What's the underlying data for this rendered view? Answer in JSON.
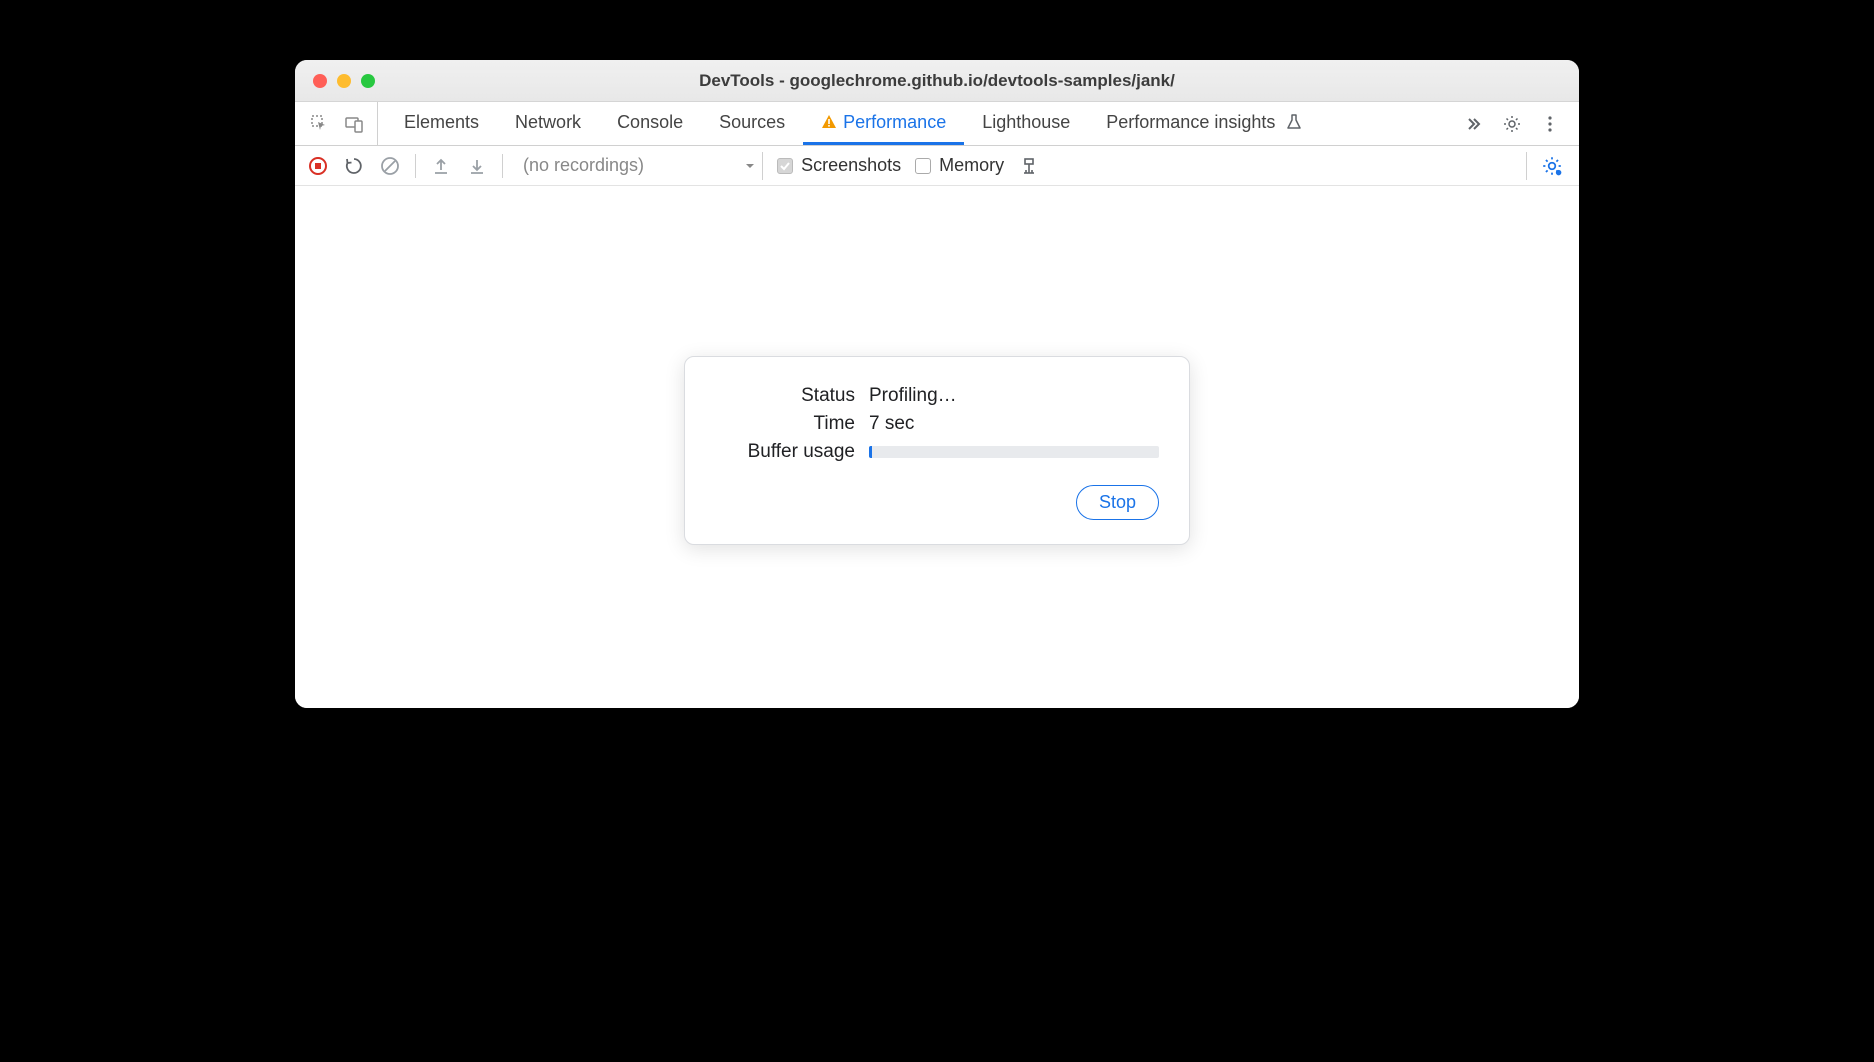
{
  "window": {
    "title": "DevTools - googlechrome.github.io/devtools-samples/jank/"
  },
  "tabs": {
    "items": [
      {
        "label": "Elements"
      },
      {
        "label": "Network"
      },
      {
        "label": "Console"
      },
      {
        "label": "Sources"
      },
      {
        "label": "Performance",
        "active": true,
        "warning": true
      },
      {
        "label": "Lighthouse"
      },
      {
        "label": "Performance insights"
      }
    ]
  },
  "toolbar": {
    "recordings_placeholder": "(no recordings)",
    "screenshots_label": "Screenshots",
    "screenshots_checked": true,
    "memory_label": "Memory",
    "memory_checked": false
  },
  "dialog": {
    "status_label": "Status",
    "status_value": "Profiling…",
    "time_label": "Time",
    "time_value": "7 sec",
    "buffer_label": "Buffer usage",
    "buffer_percent": 1,
    "stop_label": "Stop"
  }
}
